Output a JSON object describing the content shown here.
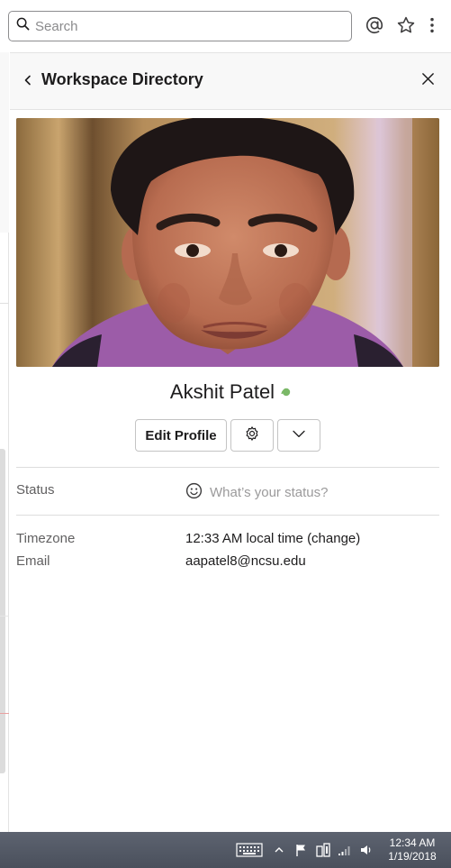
{
  "search": {
    "placeholder": "Search",
    "icon": "search-icon"
  },
  "top_icons": [
    "mentions-icon",
    "star-icon",
    "more-vertical-icon"
  ],
  "panel": {
    "title": "Workspace Directory",
    "back_icon": "chevron-left-icon",
    "close_icon": "close-icon"
  },
  "profile": {
    "name": "Akshit Patel",
    "presence_icon": "active-presence-icon",
    "presence_color": "#7ab867",
    "actions": {
      "edit_label": "Edit Profile",
      "settings_icon": "gear-icon",
      "more_icon": "chevron-down-icon"
    },
    "status": {
      "label": "Status",
      "placeholder": "What’s your status?",
      "icon": "smiley-icon"
    },
    "timezone": {
      "label": "Timezone",
      "value": "12:33 AM local time (change)"
    },
    "email": {
      "label": "Email",
      "value": "aapatel8@ncsu.edu"
    }
  },
  "taskbar": {
    "icons": [
      "keyboard-icon",
      "tray-up-icon",
      "flag-icon",
      "network-icon",
      "signal-icon",
      "volume-icon"
    ],
    "time": "12:34 AM",
    "date": "1/19/2018"
  }
}
